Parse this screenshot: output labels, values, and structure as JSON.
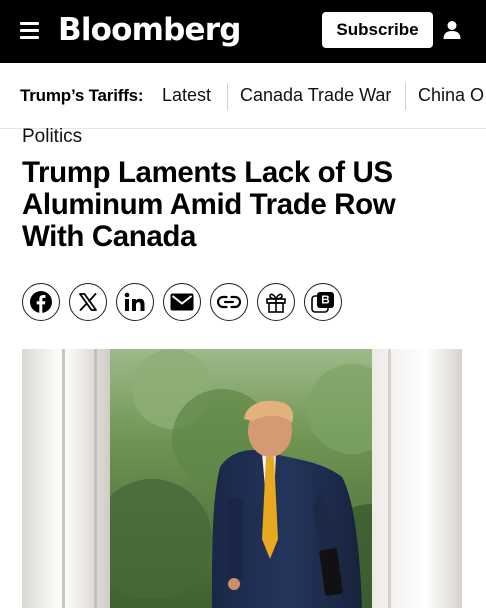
{
  "header": {
    "logo_text": "Bloomberg",
    "subscribe_label": "Subscribe"
  },
  "trending": {
    "label": "Trump’s Tariffs:",
    "items": [
      "Latest",
      "Canada Trade War",
      "China O"
    ]
  },
  "article": {
    "section": "Politics",
    "headline_lines": [
      "Trump Laments Lack of US",
      "Aluminum Amid Trade Row",
      "With Canada"
    ]
  },
  "share": {
    "buttons": [
      "facebook-icon",
      "x-icon",
      "linkedin-icon",
      "email-icon",
      "link-icon",
      "gift-icon",
      "bloomberg-terminal-icon"
    ]
  },
  "colors": {
    "header_bg": "#000000",
    "text": "#000000",
    "divider": "#cfcfcf"
  }
}
